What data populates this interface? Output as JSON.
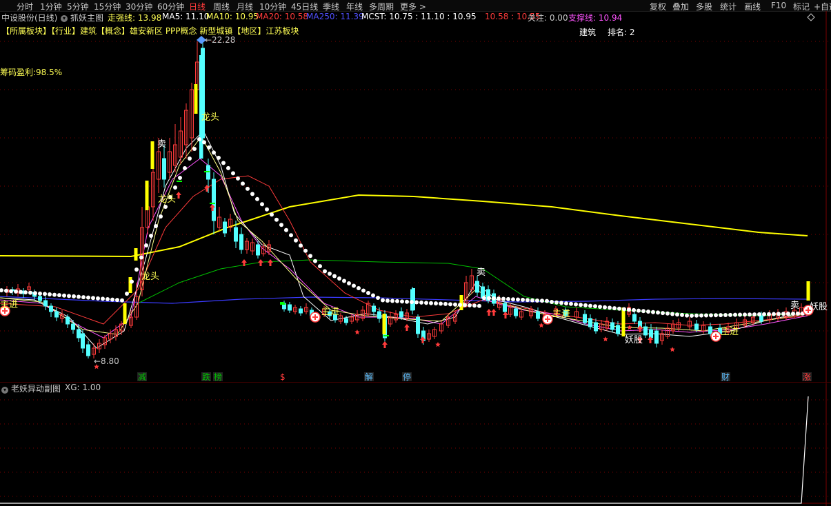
{
  "tabs": [
    "分时",
    "1分钟",
    "5分钟",
    "15分钟",
    "30分钟",
    "60分钟",
    "日线",
    "周线",
    "月线",
    "10分钟",
    "45日线",
    "季线",
    "年线",
    "多周期",
    "更多 >"
  ],
  "active_tab": "日线",
  "right_tabs": [
    "复权",
    "叠加",
    "多股",
    "统计",
    "画线",
    "F10",
    "标记",
    "+自选"
  ],
  "info": {
    "stock": "中设股份(日线)",
    "indicator": "抓妖主图",
    "zqx": "走强线: 13.98",
    "ma5": "MA5: 11.10",
    "ma10": "MA10: 10.95",
    "ma20": "MA20: 10.58",
    "ma250": "MA250: 11.39",
    "mcst": "MCST: 10.75 : 11.10 : 10.95",
    "v2": "10.58 : 10.55",
    "focus": "关注: 0.00",
    "support": "支撑线: 10.94"
  },
  "sector": {
    "line": "【所属板块】【行业】建筑【概念】雄安新区 PPP概念 新型城镇【地区】江苏板块",
    "industry": "建筑",
    "rank": "排名: 2"
  },
  "chip": "筹码盈利:98.5%",
  "price_high": "22.28",
  "price_low": "8.80",
  "labels": {
    "sell": "卖",
    "dragon_head": "龙头",
    "pulse": "主进",
    "demon": "妖股"
  },
  "event_tags": [
    "减",
    "跌",
    "榜",
    "$",
    "解",
    "停",
    "财",
    "涨"
  ],
  "sub_chart": {
    "title": "老妖异动副图",
    "xg": "XG: 1.00"
  },
  "colors": {
    "up": "#ff3b3b",
    "down": "#54ffff",
    "ma5": "#ffffff",
    "ma10": "#ffff54",
    "ma20": "#ff3b3b",
    "ma250": "#3b3bff",
    "mcst": "#ffffff",
    "support": "#ff54ff",
    "yellow": "#ffff00",
    "green": "#00c000"
  }
}
